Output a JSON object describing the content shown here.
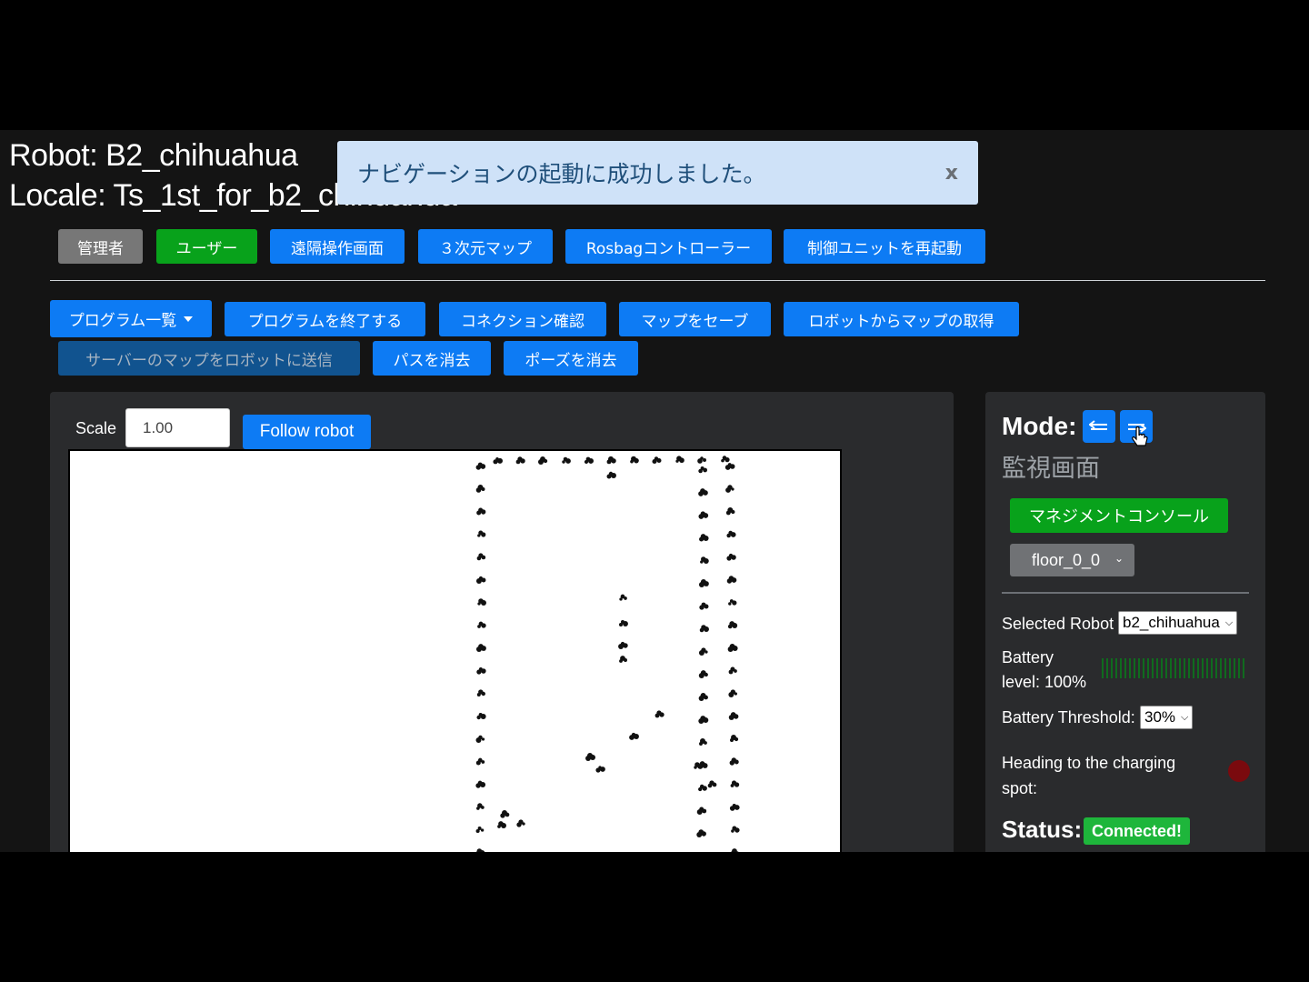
{
  "header": {
    "robot_line": "Robot: B2_chihuahua",
    "locale_line": "Locale: Ts_1st_for_b2_chihuahua"
  },
  "toast": {
    "message": "ナビゲーションの起動に成功しました。",
    "close": "x"
  },
  "top_nav": {
    "admin": "管理者",
    "user": "ユーザー",
    "teleop": "遠隔操作画面",
    "map3d": "３次元マップ",
    "rosbag": "Rosbagコントローラー",
    "restart": "制御ユニットを再起動"
  },
  "toolbar": {
    "programs": "プログラム一覧",
    "stop_program": "プログラムを終了する",
    "check_connection": "コネクション確認",
    "save_map": "マップをセーブ",
    "get_map": "ロボットからマップの取得",
    "send_map": "サーバーのマップをロボットに送信",
    "clear_path": "パスを消去",
    "clear_pose": "ポーズを消去"
  },
  "map_panel": {
    "scale_label": "Scale",
    "scale_value": "1.00",
    "follow_label": "Follow robot"
  },
  "side_panel": {
    "mode_label": "Mode:",
    "mode_left_icon": "arrow-left-icon",
    "mode_right_icon": "arrow-right-icon",
    "mode_name": "監視画面",
    "management_console": "マネジメントコンソール",
    "floor_selected": "floor_0_0",
    "selected_robot_label": "Selected Robot",
    "selected_robot_value": "b2_chihuahua",
    "battery_label_1": "Battery",
    "battery_label_2": "level: 100%",
    "battery_level_fraction": 1.0,
    "battery_threshold_label": "Battery Threshold:",
    "battery_threshold_value": "30%",
    "heading_label_1": "Heading to the charging",
    "heading_label_2": "spot:",
    "heading_indicator_color": "#7a0a0e",
    "status_label": "Status:",
    "status_value": "Connected!"
  },
  "colors": {
    "primary": "#0d7bf4",
    "success": "#08a21b",
    "secondary": "#777777",
    "status_green": "#1eb63b",
    "toast_bg": "#cfe2f8"
  }
}
